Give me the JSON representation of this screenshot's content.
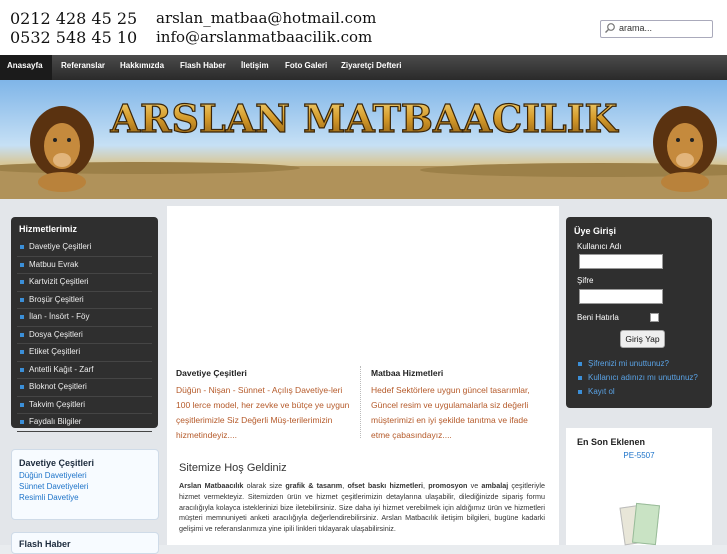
{
  "header": {
    "phones": [
      "0212 428 45 25",
      "0532 548 45 10"
    ],
    "emails": [
      "arslan_matbaa@hotmail.com",
      "info@arslanmatbaacilik.com"
    ],
    "search_placeholder": "arama..."
  },
  "nav": {
    "items": [
      "Anasayfa",
      "Referanslar",
      "Hakkımızda",
      "Flash Haber",
      "İletişim",
      "Foto Galeri",
      "Ziyaretçi Defteri"
    ],
    "active": "Anasayfa"
  },
  "banner": {
    "title": "ARSLAN MATBAACILIK"
  },
  "sidebar": {
    "services_title": "Hizmetlerimiz",
    "services": [
      "Davetiye Çeşitleri",
      "Matbuu Evrak",
      "Kartvizit Çeşitleri",
      "Broşür Çeşitleri",
      "İlan - İnsört - Föy",
      "Dosya Çeşitleri",
      "Etiket Çeşitleri",
      "Antetli Kağıt - Zarf",
      "Bloknot Çeşitleri",
      "Takvim Çeşitleri",
      "Faydalı Bilgiler"
    ],
    "invites_title": "Davetiye Çeşitleri",
    "invites": [
      "Düğün Davetiyeleri",
      "Sünnet Davetiyeleri",
      "Resimli Davetiye"
    ],
    "flash_title": "Flash Haber"
  },
  "content": {
    "col1": {
      "title": "Davetiye Çeşitleri",
      "text": "Düğün - Nişan - Sünnet - Açılış Davetiye-leri 100 lerce model, her zevke ve bütçe ye uygun çeşitlerimizle Siz Değerli Müş-terilerimizin hizmetindeyiz...."
    },
    "col2": {
      "title": "Matbaa Hizmetleri",
      "text": "Hedef Sektörlere uygun güncel tasarımlar, Güncel resim ve uygulamalarla siz değerli müşterimizi en iyi şekilde tanıtma ve ifade etme çabasındayız...."
    },
    "welcome": {
      "title": "Sitemize Hoş Geldiniz",
      "bold1": "Arslan Matbaacılık",
      "t1": " olarak size ",
      "bold2": "grafik & tasarım",
      "t2": ", ",
      "bold3": "ofset baskı hizmetleri",
      "t3": ", ",
      "bold4": "promosyon",
      "t4": " ve ",
      "bold5": "ambalaj",
      "t5": " çeşitleriyle hizmet vermekteyiz. Sitemizden ürün ve hizmet çeşitlerimizin detaylarına ulaşabilir, dilediğinizde sipariş formu aracılığıyla kolayca isteklerinizi bize iletebilirsiniz. Size daha iyi hizmet verebilmek için aldığımız ürün ve hizmetleri müşteri memnuniyeti anketi aracılığıyla değerlendirebilirsiniz. Arslan Matbacılık iletişim bilgileri, bugüne kadarki gelişimi ve referanslarımıza yine ipili linkleri tıklayarak ulaşabilirsiniz."
    }
  },
  "login": {
    "title": "Üye Girişi",
    "username_label": "Kullanıcı Adı",
    "password_label": "Şifre",
    "remember_label": "Beni Hatırla",
    "submit_label": "Giriş Yap",
    "links": [
      "Şifrenizi mi unuttunuz?",
      "Kullanıcı adınızı mı unuttunuz?",
      "Kayıt ol"
    ]
  },
  "latest": {
    "title": "En Son Eklenen",
    "item": "PE-5507"
  },
  "colors": {
    "accent": "#3b8fd8",
    "nav_bg": "#333333",
    "link": "#1d73c9",
    "orange_text": "#b55a2a"
  }
}
